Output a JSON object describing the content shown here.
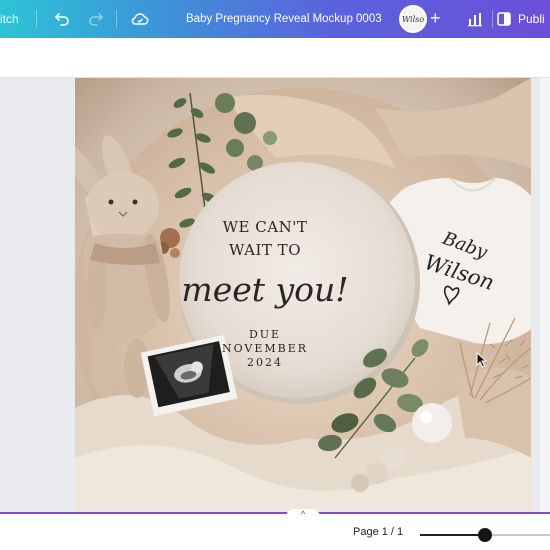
{
  "toolbar": {
    "switch_label": "itch",
    "undo_icon": "undo-icon",
    "redo_icon": "redo-icon",
    "cloud_icon": "cloud-sync-icon",
    "doc_title": "Baby Pregnancy Reveal Mockup 0003",
    "avatar_text": "Wilso",
    "add_label": "+",
    "analytics_icon": "bar-chart-icon",
    "publish_label": "Publi",
    "gradient_colors": [
      "#2cc4d6",
      "#3a9ad8",
      "#5a63dc",
      "#6c4fd9"
    ]
  },
  "design": {
    "sign": {
      "line1": "WE CAN'T",
      "line2": "WAIT TO",
      "script": "meet you!",
      "due": "DUE",
      "month": "NOVEMBER",
      "year": "2024"
    },
    "onesie": {
      "line1": "Baby",
      "line2": "Wilson"
    }
  },
  "footer": {
    "collapse_icon": "chevron-up-icon",
    "page_label": "Page 1 / 1",
    "zoom_fraction": 0.5,
    "accent_color": "#7d4ce0"
  }
}
